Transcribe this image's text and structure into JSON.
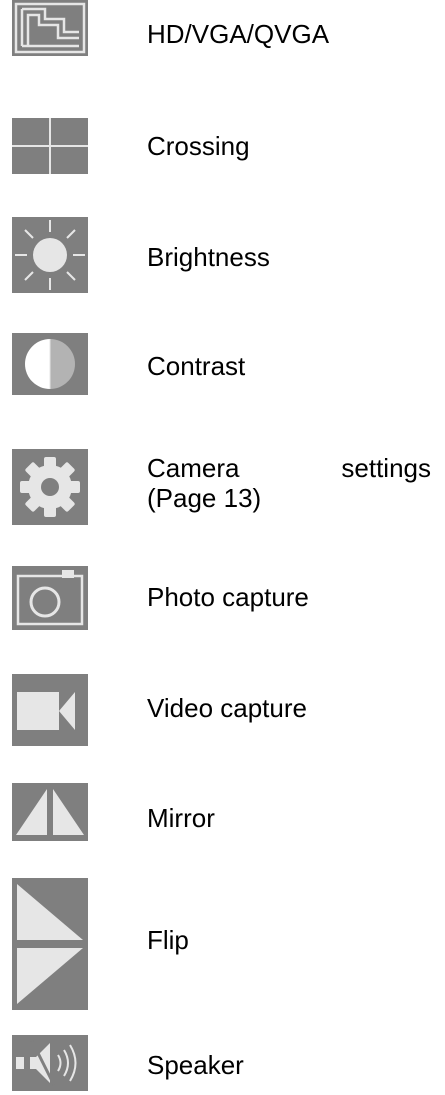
{
  "items": [
    {
      "icon": "resolution-icon",
      "label": "HD/VGA/QVGA"
    },
    {
      "icon": "crossing-icon",
      "label": "Crossing"
    },
    {
      "icon": "brightness-icon",
      "label": "Brightness"
    },
    {
      "icon": "contrast-icon",
      "label": "Contrast"
    },
    {
      "icon": "gear-icon",
      "label_line1_a": "Camera",
      "label_line1_b": "settings",
      "label_line2": "(Page 13)"
    },
    {
      "icon": "camera-icon",
      "label": "Photo capture"
    },
    {
      "icon": "video-camera-icon",
      "label": "Video capture"
    },
    {
      "icon": "mirror-icon",
      "label": "Mirror"
    },
    {
      "icon": "flip-icon",
      "label": "Flip"
    },
    {
      "icon": "speaker-icon",
      "label": "Speaker"
    }
  ],
  "colors": {
    "icon_background": "#7f7f7f",
    "icon_foreground": "#e6e6e6",
    "text": "#000000"
  }
}
